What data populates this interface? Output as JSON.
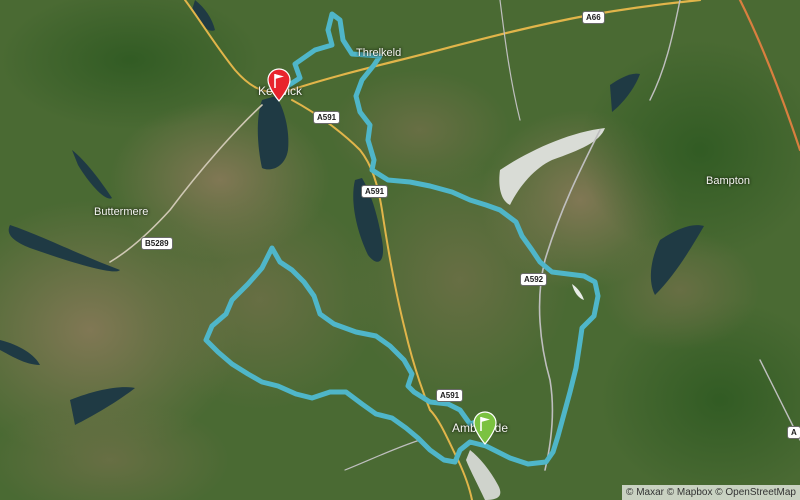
{
  "map": {
    "places": [
      {
        "id": "keswick",
        "label": "Keswick"
      },
      {
        "id": "threlkeld",
        "label": "Threlkeld"
      },
      {
        "id": "buttermere",
        "label": "Buttermere"
      },
      {
        "id": "bampton",
        "label": "Bampton"
      },
      {
        "id": "ambleside",
        "label": "Ambleside"
      }
    ],
    "road_labels": {
      "a66": "A66",
      "a591_north": "A591",
      "a591_mid": "A591",
      "a591_south": "A591",
      "b5289": "B5289",
      "a592": "A592",
      "a_edge": "A"
    },
    "route": {
      "color": "#4fb6c9",
      "start_marker_color": "#e8242d",
      "end_marker_color": "#7bc241",
      "start_icon": "flag-icon",
      "end_icon": "flag-icon"
    },
    "attribution": {
      "icon": "copyright-icon",
      "text": "© Maxar © Mapbox © OpenStreetMap"
    }
  }
}
